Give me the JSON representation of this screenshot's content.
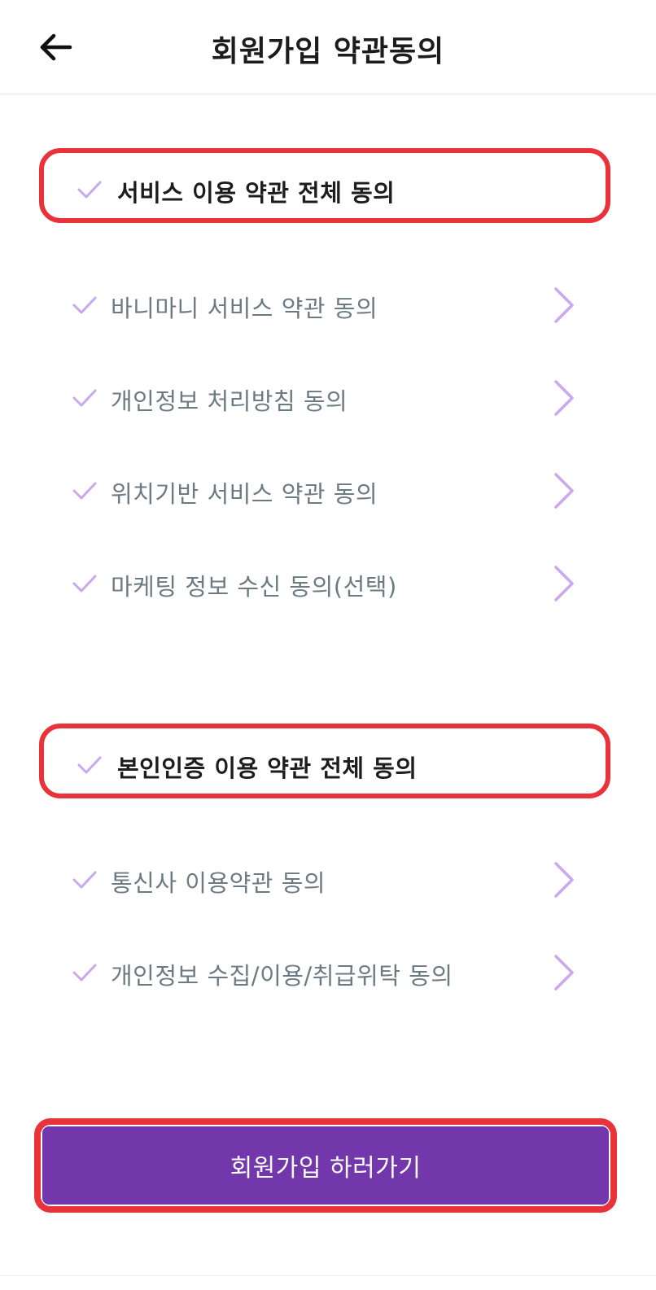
{
  "header": {
    "title": "회원가입 약관동의",
    "back_icon": "arrow-left-icon"
  },
  "service_terms": {
    "all_agree_label": "서비스 이용 약관 전체 동의",
    "items": [
      {
        "label": "바니마니 서비스 약관 동의"
      },
      {
        "label": "개인정보 처리방침 동의"
      },
      {
        "label": "위치기반 서비스 약관 동의"
      },
      {
        "label": "마케팅 정보 수신 동의(선택)"
      }
    ]
  },
  "identity_terms": {
    "all_agree_label": "본인인증 이용 약관 전체 동의",
    "items": [
      {
        "label": "통신사 이용약관 동의"
      },
      {
        "label": "개인정보 수집/이용/취급위탁 동의"
      }
    ]
  },
  "submit": {
    "label": "회원가입 하러가기"
  },
  "colors": {
    "primary": "#7137ab",
    "check": "#c8a8ee",
    "chevron": "#c8a8ee",
    "highlight_border": "#e8333a",
    "item_text": "#6c7a82",
    "title_text": "#1c1c1c"
  }
}
